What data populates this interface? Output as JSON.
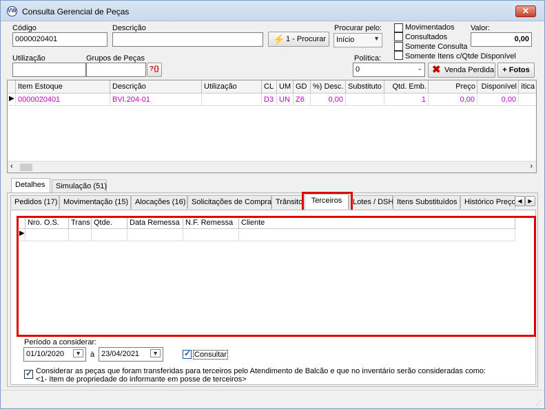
{
  "window": {
    "title": "Consulta Gerencial de Peças",
    "logo_text": "VW",
    "close_glyph": "✕"
  },
  "form": {
    "codigo_label": "Código",
    "codigo_value": "0000020401",
    "descricao_label": "Descrição",
    "descricao_value": "",
    "procurar_button": "1 - Procurar",
    "procurar_pelo_label": "Procurar pelo:",
    "procurar_pelo_value": "Início",
    "movimentados_label": "Movimentados",
    "consultados_label": "Consultados",
    "somente_consulta_label": "Somente Consulta",
    "somente_itens_label": "Somente Itens c/Qtde Disponível",
    "valor_label": "Valor:",
    "valor_value": "0,00",
    "utilizacao_label": "Utilização",
    "utilizacao_value": "",
    "grupos_label": "Grupos de Peças",
    "grupos_value": "",
    "grupos_icon_text": "?{}",
    "politica_label": "Política:",
    "politica_value": "0",
    "venda_perdida_button": "Venda Perdida",
    "fotos_button": "+ Fotos"
  },
  "items_grid": {
    "columns": [
      "Item Estoque",
      "Descrição",
      "Utilização",
      "CL",
      "UM",
      "GD",
      "%) Desc.",
      "Substituto",
      "Qtd. Emb.",
      "Preço",
      "Disponível",
      "ítica"
    ],
    "rows": [
      [
        "0000020401",
        "BVI.204-01",
        "",
        "D3",
        "UN",
        "Z6",
        "0,00",
        "",
        "1",
        "0,00",
        "0,00",
        ""
      ]
    ]
  },
  "main_tabs": [
    "Detalhes",
    "Simulação (51)"
  ],
  "sub_tabs": [
    "Pedidos (17)",
    "Movimentação (15)",
    "Alocações (16)",
    "Solicitações de Compra",
    "Trânsito",
    "Terceiros",
    "Lotes / DSH",
    "Itens Substituídos",
    "Histórico Preço"
  ],
  "terceiros_grid": {
    "columns": [
      "Nro. O.S.",
      "Trans",
      "Qtde.",
      "Data Remessa",
      "N.F. Remessa",
      "Cliente"
    ]
  },
  "periodo": {
    "label": "Período a considerar:",
    "from": "01/10/2020",
    "separator": "à",
    "to": "23/04/2021",
    "consultar_label": "Consultar"
  },
  "considerar": {
    "line1": "Considerar as peças que foram transferidas para terceiros pelo Atendimento de Balcão e que no inventário serão consideradas como:",
    "line2": "<1- Item de propriedade do informante em posse de terceiros>"
  },
  "colors": {
    "accent_red": "#e00000",
    "row_text": "#c000c0",
    "title_bg": "#c9d9ee"
  }
}
